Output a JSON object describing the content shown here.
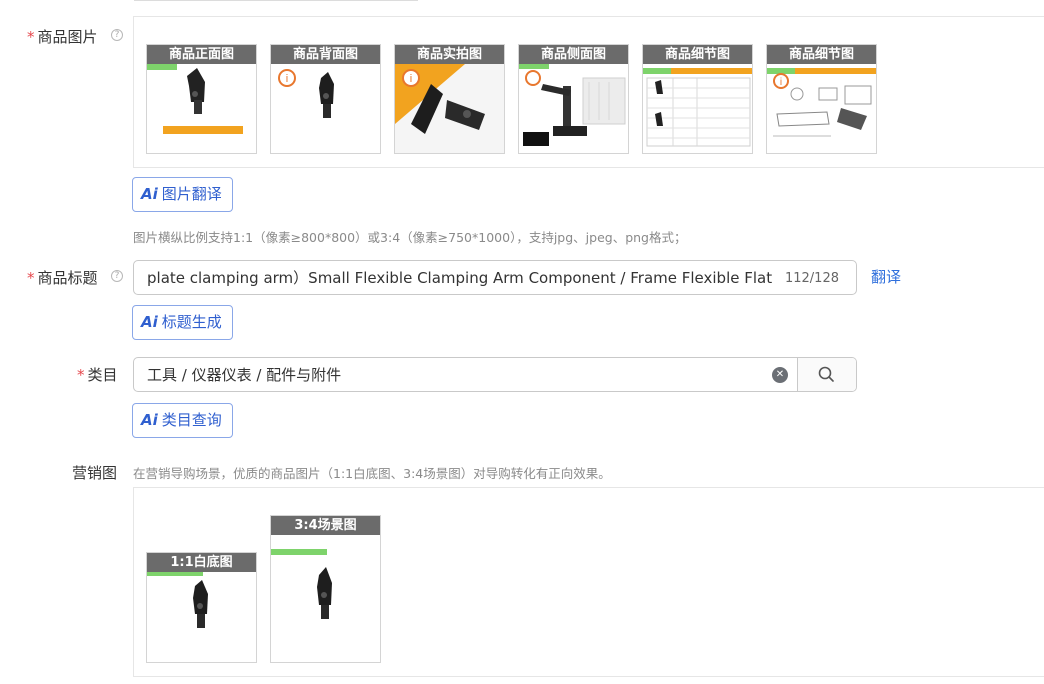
{
  "product_images": {
    "label": "商品图片",
    "required_mark": "*",
    "help": "?",
    "thumbs": [
      "商品正面图",
      "商品背面图",
      "商品实拍图",
      "商品侧面图",
      "商品细节图",
      "商品细节图"
    ],
    "ai_button_icon": "Ai",
    "ai_button_label": "图片翻译",
    "hint": "图片横纵比例支持1:1（像素≥800*800）或3:4（像素≥750*1000），支持jpg、jpeg、png格式；"
  },
  "product_title": {
    "label": "商品标题",
    "required_mark": "*",
    "help": "?",
    "value": "plate clamping arm）Small Flexible Clamping Arm  Component / Frame Flexible Flat Sheet (",
    "counter": "112/128",
    "translate_link": "翻译",
    "ai_button_icon": "Ai",
    "ai_button_label": "标题生成"
  },
  "category": {
    "label": "类目",
    "required_mark": "*",
    "value": "工具 / 仪器仪表 / 配件与附件",
    "clear_glyph": "✕",
    "ai_button_icon": "Ai",
    "ai_button_label": "类目查询"
  },
  "marketing_images": {
    "label": "营销图",
    "hint": "在营销导购场景，优质的商品图片（1:1白底图、3:4场景图）对导购转化有正向效果。",
    "thumbs": [
      "1:1白底图",
      "3:4场景图"
    ]
  },
  "colors": {
    "required": "#e5484d",
    "ai_blue": "#2f5fcf",
    "link_blue": "#2f6fdc",
    "caption_gray": "#6b6b6b",
    "accent_orange": "#f2a31f",
    "info_orange": "#e8772e"
  },
  "icons": {
    "help": "help-circle-icon",
    "info": "info-circle-icon",
    "clear": "clear-circle-icon",
    "search": "search-icon",
    "ai": "ai-icon"
  }
}
